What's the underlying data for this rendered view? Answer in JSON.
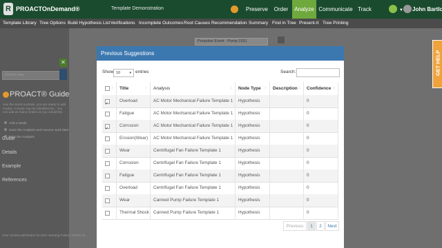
{
  "app": {
    "brand": "PROACTOnDemand®",
    "logo_letter": "R",
    "doc_title": "Template Demonstration",
    "user_name": "John Bartlow"
  },
  "topnav": [
    {
      "label": "Preserve",
      "active": false
    },
    {
      "label": "Order",
      "active": false
    },
    {
      "label": "Analyze",
      "active": true
    },
    {
      "label": "Communicate",
      "active": false
    },
    {
      "label": "Track",
      "active": false
    }
  ],
  "subnav": [
    "Template Library",
    "Tree Options",
    "Build Hypothesis List",
    "Verifications",
    "Incomplete Outcomes",
    "Root Causes",
    "Recommendation",
    "Summary",
    "Find in Tree",
    "Present-It",
    "Tree Printing"
  ],
  "sidebar": {
    "search_placeholder": "Find in tree",
    "guide_title": "PROACT® Guide",
    "guide_text": "Use the event & phase, you are ready to add modes. A mode may be identified by... You can add as many modes as you would like.",
    "steps": [
      "Add a Mode",
      "Save the Analysis and resume work later",
      "Print the Analysis"
    ],
    "sections": [
      "Guide",
      "Details",
      "Example",
      "References"
    ],
    "footer": "User clicked add-button for item: Bearing Failure, Parent id..."
  },
  "background": {
    "event_box": "Proactive Event - Pump 1531"
  },
  "help_tab": "GET HELP",
  "modal": {
    "title": "Previous Suggestions",
    "show_label": "Show",
    "entries_value": "10",
    "entries_label": "entries",
    "search_label": "Search:",
    "search_value": "",
    "columns": [
      "Title",
      "Analysis",
      "Node Type",
      "Description",
      "Confidence"
    ],
    "rows": [
      {
        "checked": true,
        "title": "Overload",
        "analysis": "AC Motor Mechanical Failure Template 1",
        "node_type": "Hypothesis",
        "description": "",
        "confidence": "0"
      },
      {
        "checked": false,
        "title": "Fatigue",
        "analysis": "AC Motor Mechanical Failure Template 1",
        "node_type": "Hypothesis",
        "description": "",
        "confidence": "0"
      },
      {
        "checked": true,
        "title": "Corrosion",
        "analysis": "AC Motor Mechanical Failure Template 1",
        "node_type": "Hypothesis",
        "description": "",
        "confidence": "0"
      },
      {
        "checked": false,
        "title": "Erosion(Wear)",
        "analysis": "AC Motor Mechanical Failure Template 1",
        "node_type": "Hypothesis",
        "description": "",
        "confidence": "0"
      },
      {
        "checked": false,
        "title": "Wear",
        "analysis": "Centrifugal Fan Failure Template 1",
        "node_type": "Hypothesis",
        "description": "",
        "confidence": "0"
      },
      {
        "checked": false,
        "title": "Corrosion",
        "analysis": "Centrifugal Fan Failure Template 1",
        "node_type": "Hypothesis",
        "description": "",
        "confidence": "0"
      },
      {
        "checked": false,
        "title": "Fatigue",
        "analysis": "Centrifugal Fan Failure Template 1",
        "node_type": "Hypothesis",
        "description": "",
        "confidence": "0"
      },
      {
        "checked": false,
        "title": "Overload",
        "analysis": "Centrifugal Fan Failure Template 1",
        "node_type": "Hypothesis",
        "description": "",
        "confidence": "0"
      },
      {
        "checked": false,
        "title": "Wear",
        "analysis": "Canned Pump Failure Template 1",
        "node_type": "Hypothesis",
        "description": "",
        "confidence": "0"
      },
      {
        "checked": false,
        "title": "Thermal Shock",
        "analysis": "Canned Pump Failure Template 1",
        "node_type": "Hypothesis",
        "description": "",
        "confidence": "0"
      }
    ],
    "pagination": {
      "previous": "Previous",
      "pages": [
        "1",
        "2"
      ],
      "current": "1",
      "next": "Next"
    }
  },
  "colors": {
    "topbar": "#1a4b2e",
    "accent_green": "#6fa83d",
    "modal_header": "#3c78b0",
    "help_orange": "#f0a33a"
  }
}
